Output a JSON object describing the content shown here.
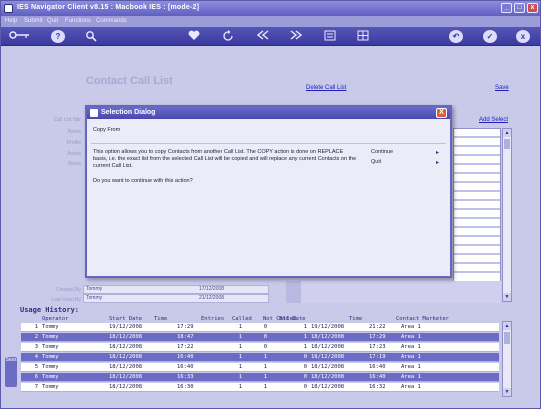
{
  "window": {
    "title": "IES Navigator Client v8.15 : Macbook IES :        [mode-2]",
    "controls": [
      "_",
      "□",
      "x"
    ]
  },
  "menu": {
    "items": [
      "Help",
      "Submit",
      "Quit",
      "Functions",
      "Commands"
    ]
  },
  "toolbar": {
    "icons": [
      "key-icon",
      "help-icon",
      "search-icon",
      "heart-icon",
      "refresh-icon",
      "first-icon",
      "next-icon",
      "list-icon",
      "grid-icon",
      "back-icon",
      "check-icon",
      "close-icon"
    ],
    "help_glyph": "?",
    "back_glyph": "↶",
    "check_glyph": "✓",
    "close_glyph": "x"
  },
  "form": {
    "title": "Contact Call List",
    "delete_link": "Delete Call List",
    "save_link": "Save",
    "add_select_link": "Add Select",
    "field_labels": [
      "Call List Nbr",
      "Name",
      "Profile",
      "Active",
      "Notes"
    ],
    "created_by_label": "Created By",
    "created_by_value": "Tommy",
    "created_date": "17/12/2008",
    "last_used_by_label": "Last Used By",
    "last_used_by_value": "Tommy",
    "last_used_date": "21/12/2008"
  },
  "usage_history": {
    "title": "Usage History:",
    "columns": [
      "Operator",
      "Start Date",
      "Time",
      "Entries",
      "Called",
      "Not Called",
      "End Date",
      "Time",
      "Contact Marketer"
    ],
    "rows": [
      {
        "n": "1",
        "op": "Tommy",
        "sd": "19/12/2008",
        "t1": "17:29",
        "en": "1",
        "ca": "0",
        "nc": "1",
        "ed": "19/12/2008",
        "t2": "21:22",
        "cm": "Area 1"
      },
      {
        "n": "2",
        "op": "Tommy",
        "sd": "18/12/2008",
        "t1": "18:47",
        "en": "1",
        "ca": "0",
        "nc": "1",
        "ed": "18/12/2008",
        "t2": "17:29",
        "cm": "Area 1"
      },
      {
        "n": "3",
        "op": "Tommy",
        "sd": "18/12/2008",
        "t1": "17:22",
        "en": "1",
        "ca": "0",
        "nc": "1",
        "ed": "18/12/2008",
        "t2": "17:23",
        "cm": "Area 1"
      },
      {
        "n": "4",
        "op": "Tommy",
        "sd": "18/12/2008",
        "t1": "16:40",
        "en": "1",
        "ca": "1",
        "nc": "0",
        "ed": "18/12/2008",
        "t2": "17:19",
        "cm": "Area 1"
      },
      {
        "n": "5",
        "op": "Tommy",
        "sd": "18/12/2008",
        "t1": "16:40",
        "en": "1",
        "ca": "1",
        "nc": "0",
        "ed": "18/12/2008",
        "t2": "16:40",
        "cm": "Area 1"
      },
      {
        "n": "6",
        "op": "Tommy",
        "sd": "18/12/2008",
        "t1": "16:33",
        "en": "1",
        "ca": "1",
        "nc": "0",
        "ed": "18/12/2008",
        "t2": "16:40",
        "cm": "Area 1"
      },
      {
        "n": "7",
        "op": "Tommy",
        "sd": "18/12/2008",
        "t1": "16:30",
        "en": "1",
        "ca": "1",
        "nc": "0",
        "ed": "18/12/2008",
        "t2": "16:32",
        "cm": "Area 1"
      }
    ]
  },
  "dialog": {
    "title": "Selection Dialog",
    "close_glyph": "X",
    "heading": "Copy From",
    "body": "This option allows you to copy Contacts from another Call List. The COPY action is done on REPLACE basis, i.e. the exact list from the selected Call List will be copied and will replace any current Contacts on the current Call List.",
    "question": "Do you want to continue with this action?",
    "options": [
      "Continue",
      "Quit"
    ],
    "option_arrow": "▸"
  },
  "left_strip_label": "Sess"
}
